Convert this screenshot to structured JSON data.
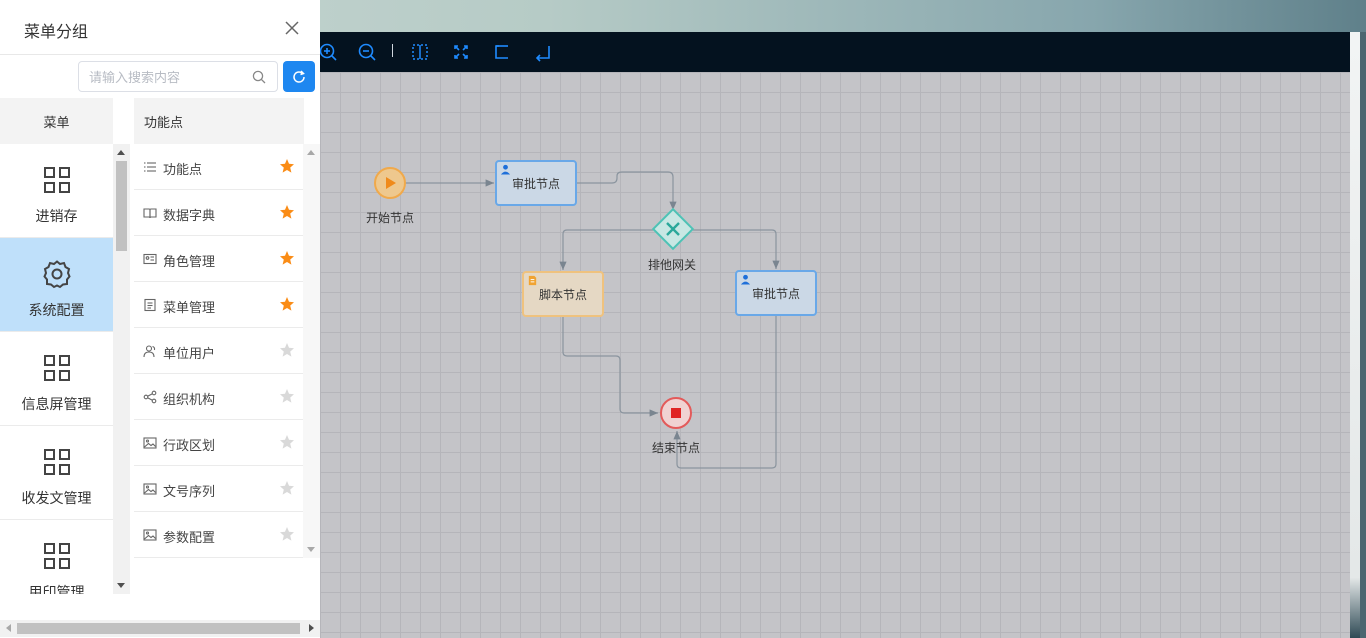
{
  "panel": {
    "title": "菜单分组",
    "search_placeholder": "请输入搜索内容",
    "menu_header": "菜单",
    "func_header": "功能点"
  },
  "menus": [
    {
      "label": "进销存",
      "icon": "grid-icon",
      "active": false
    },
    {
      "label": "系统配置",
      "icon": "gear-icon",
      "active": true
    },
    {
      "label": "信息屏管理",
      "icon": "grid-icon",
      "active": false
    },
    {
      "label": "收发文管理",
      "icon": "grid-icon",
      "active": false
    },
    {
      "label": "用印管理",
      "icon": "grid-icon",
      "active": false
    }
  ],
  "functions": [
    {
      "label": "功能点",
      "icon": "list-icon",
      "starred": true
    },
    {
      "label": "数据字典",
      "icon": "book-icon",
      "starred": true
    },
    {
      "label": "角色管理",
      "icon": "id-card-icon",
      "starred": true
    },
    {
      "label": "菜单管理",
      "icon": "document-icon",
      "starred": true
    },
    {
      "label": "单位用户",
      "icon": "users-icon",
      "starred": false
    },
    {
      "label": "组织机构",
      "icon": "share-icon",
      "starred": false
    },
    {
      "label": "行政区划",
      "icon": "image-icon",
      "starred": false
    },
    {
      "label": "文号序列",
      "icon": "image-icon",
      "starred": false
    },
    {
      "label": "参数配置",
      "icon": "image-icon",
      "starred": false
    }
  ],
  "toolbar": [
    "zoom-in-icon",
    "zoom-out-icon",
    "fit-width-icon",
    "fullscreen-icon",
    "undo-icon",
    "redo-icon"
  ],
  "flow": {
    "start": "开始节点",
    "approve1": "审批节点",
    "gateway": "排他网关",
    "script": "脚本节点",
    "approve2": "审批节点",
    "end": "结束节点"
  },
  "colors": {
    "accent": "#1e87f0",
    "active_menu": "#bfe0fa",
    "star_on": "#fa8c16",
    "star_off": "#d9d9d9",
    "toolbar_bg": "#04121f"
  }
}
